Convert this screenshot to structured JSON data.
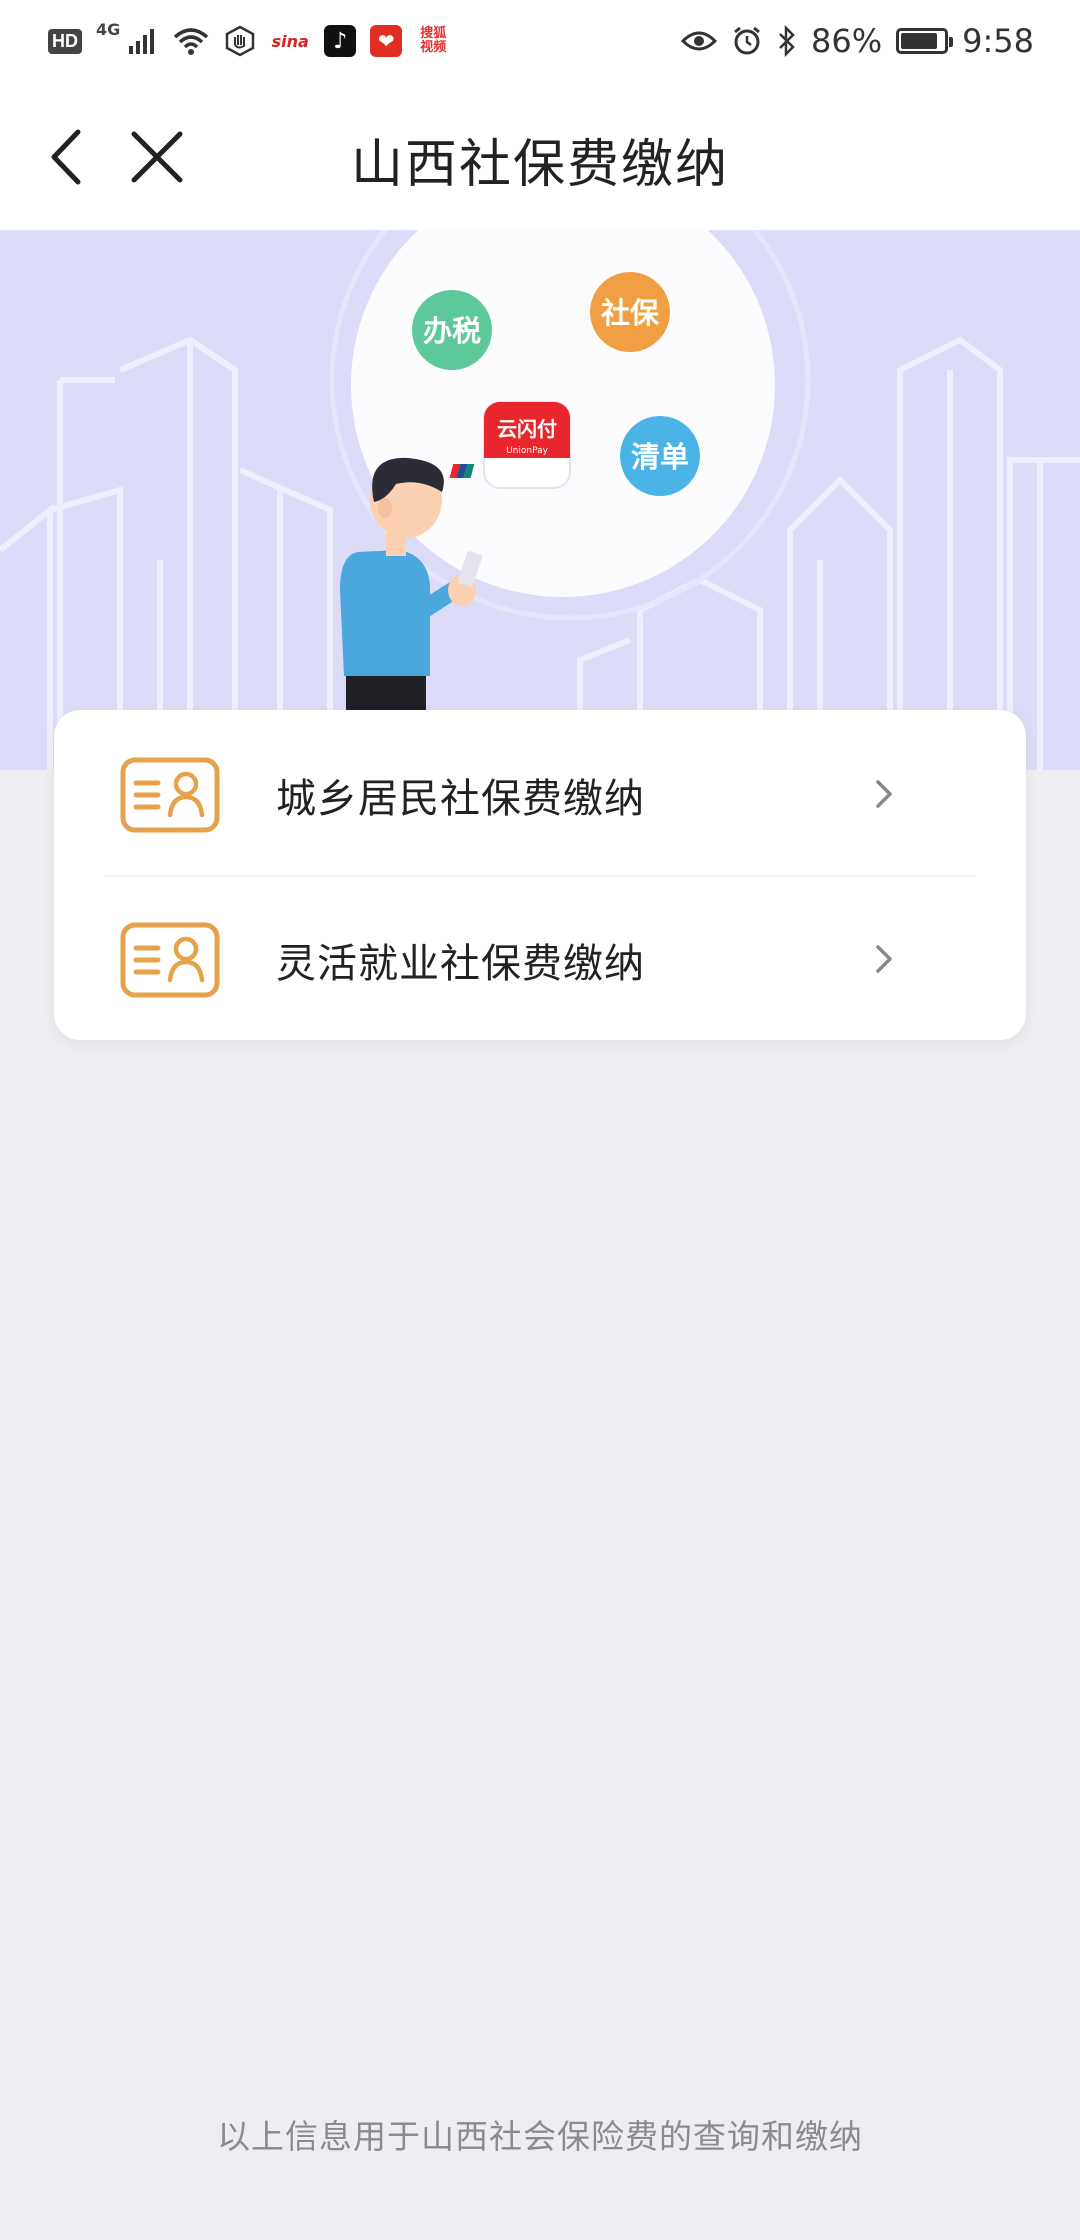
{
  "status_bar": {
    "hd_label": "HD",
    "signal_label": "4G",
    "sina_label": "sina",
    "sogou_label": "搜狐视频",
    "battery_percent": "86%",
    "battery_level": 0.86,
    "time": "9:58",
    "icons": [
      "hd-badge",
      "signal-icon",
      "wifi-icon",
      "hand-icon",
      "sina-app-icon",
      "tiktok-app-icon",
      "pinduoduo-app-icon",
      "sogou-video-app-icon",
      "eye-icon",
      "alarm-icon",
      "bluetooth-icon",
      "battery-icon"
    ]
  },
  "nav": {
    "title": "山西社保费缴纳",
    "back_icon": "chevron-left-icon",
    "close_icon": "close-icon"
  },
  "banner": {
    "bubbles": {
      "tax": "办税",
      "social_security": "社保",
      "list": "清单"
    },
    "unionpay_app_label": "云闪付",
    "unionpay_sub": "UnionPay",
    "colors": {
      "background": "#dcdcf8",
      "tax_bubble": "#5dc89a",
      "social_bubble": "#f0a042",
      "list_bubble": "#4ab4e6",
      "unionpay_red": "#e8262c"
    }
  },
  "menu": {
    "items": [
      {
        "label": "城乡居民社保费缴纳",
        "icon": "id-card-icon"
      },
      {
        "label": "灵活就业社保费缴纳",
        "icon": "id-card-icon"
      }
    ],
    "icon_color": "#e6a24a"
  },
  "footer": {
    "note": "以上信息用于山西社会保险费的查询和缴纳"
  }
}
